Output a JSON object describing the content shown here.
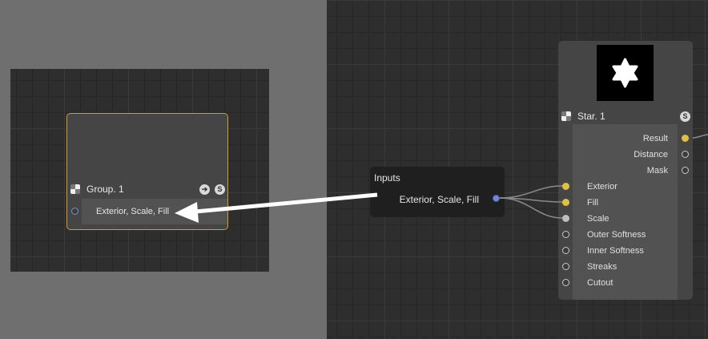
{
  "group_node": {
    "title": "Group. 1",
    "port_label": "Exterior, Scale, Fill",
    "header_buttons": [
      "arrow-right-icon",
      "s-icon"
    ],
    "s_badge": "S"
  },
  "inputs_node": {
    "title": "Inputs",
    "port_label": "Exterior, Scale, Fill"
  },
  "star_node": {
    "title": "Star. 1",
    "s_badge": "S",
    "outputs": [
      "Result",
      "Distance",
      "Mask"
    ],
    "inputs": [
      "Exterior",
      "Fill",
      "Scale",
      "Outer Softness",
      "Inner Softness",
      "Streaks",
      "Cutout"
    ]
  },
  "colors": {
    "group_border": "#d29b35",
    "port_yellow": "#e0c040",
    "port_blue": "#6f86d9",
    "arrow": "#ffffff"
  }
}
